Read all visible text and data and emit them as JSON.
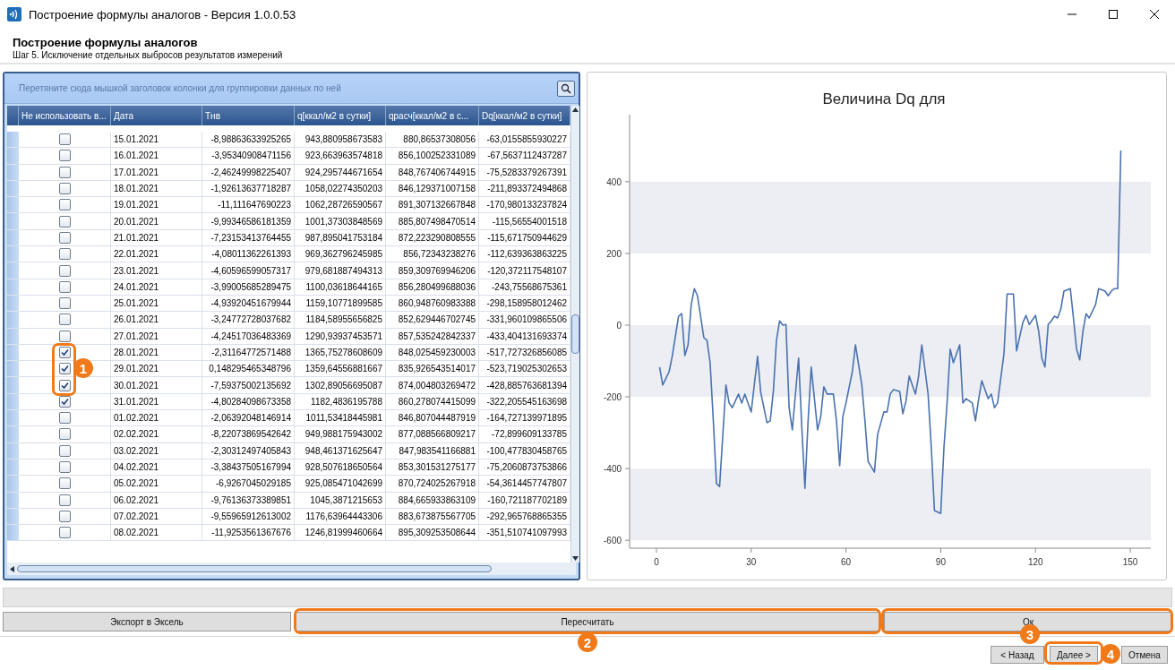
{
  "window": {
    "title": "Построение формулы аналогов - Версия 1.0.0.53"
  },
  "header": {
    "title": "Построение формулы аналогов",
    "subtitle": "Шаг 5. Исключение отдельных выбросов результатов измерений"
  },
  "grid": {
    "group_hint": "Перетяните сюда мышкой заголовок колонки для группировки данных по ней",
    "check_column": "Не использовать в...",
    "columns": [
      "Дата",
      "Тнв",
      "q[ккал/м2 в сутки]",
      "qрасч[ккал/м2 в с...",
      "Dq[ккал/м2 в сутки]"
    ],
    "rows": [
      {
        "excluded": false,
        "cells": [
          "15.01.2021",
          "-8,98863633925265",
          "943,880958673583",
          "880,86537308056",
          "-63,0155855930227"
        ]
      },
      {
        "excluded": false,
        "cells": [
          "16.01.2021",
          "-3,95340908471156",
          "923,663963574818",
          "856,100252331089",
          "-67,5637112437287"
        ]
      },
      {
        "excluded": false,
        "cells": [
          "17.01.2021",
          "-2,46249998225407",
          "924,295744671654",
          "848,767406744915",
          "-75,5283379267391"
        ]
      },
      {
        "excluded": false,
        "cells": [
          "18.01.2021",
          "-1,92613637718287",
          "1058,02274350203",
          "846,129371007158",
          "-211,893372494868"
        ]
      },
      {
        "excluded": false,
        "cells": [
          "19.01.2021",
          "-11,111647690223",
          "1062,28726590567",
          "891,307132667848",
          "-170,980133237824"
        ]
      },
      {
        "excluded": false,
        "cells": [
          "20.01.2021",
          "-9,99346586181359",
          "1001,37303848569",
          "885,807498470514",
          "-115,56554001518"
        ]
      },
      {
        "excluded": false,
        "cells": [
          "21.01.2021",
          "-7,23153413764455",
          "987,895041753184",
          "872,223290808555",
          "-115,671750944629"
        ]
      },
      {
        "excluded": false,
        "cells": [
          "22.01.2021",
          "-4,08011362261393",
          "969,362796245985",
          "856,72343238276",
          "-112,639363863225"
        ]
      },
      {
        "excluded": false,
        "cells": [
          "23.01.2021",
          "-4,60596599057317",
          "979,681887494313",
          "859,309769946206",
          "-120,372117548107"
        ]
      },
      {
        "excluded": false,
        "cells": [
          "24.01.2021",
          "-3,99005685289475",
          "1100,03618644165",
          "856,280499688036",
          "-243,75568675361"
        ]
      },
      {
        "excluded": false,
        "cells": [
          "25.01.2021",
          "-4,93920451679944",
          "1159,10771899585",
          "860,948760983388",
          "-298,158958012462"
        ]
      },
      {
        "excluded": false,
        "cells": [
          "26.01.2021",
          "-3,24772728037682",
          "1184,58955656825",
          "852,629446702745",
          "-331,960109865506"
        ]
      },
      {
        "excluded": false,
        "cells": [
          "27.01.2021",
          "-4,24517036483369",
          "1290,93937453571",
          "857,535242842337",
          "-433,404131693374"
        ]
      },
      {
        "excluded": true,
        "cells": [
          "28.01.2021",
          "-2,31164772571488",
          "1365,75278608609",
          "848,025459230003",
          "-517,727326856085"
        ]
      },
      {
        "excluded": true,
        "cells": [
          "29.01.2021",
          "0,148295465348796",
          "1359,64556881667",
          "835,926543514017",
          "-523,719025302653"
        ]
      },
      {
        "excluded": true,
        "cells": [
          "30.01.2021",
          "-7,59375002135692",
          "1302,89056695087",
          "874,004803269472",
          "-428,885763681394"
        ]
      },
      {
        "excluded": true,
        "cells": [
          "31.01.2021",
          "-4,80284098673358",
          "1182,4836195788",
          "860,278074415099",
          "-322,205545163698"
        ]
      },
      {
        "excluded": false,
        "cells": [
          "01.02.2021",
          "-2,06392048146914",
          "1011,53418445981",
          "846,807044487919",
          "-164,727139971895"
        ]
      },
      {
        "excluded": false,
        "cells": [
          "02.02.2021",
          "-8,22073869542642",
          "949,988175943002",
          "877,088566809217",
          "-72,899609133785"
        ]
      },
      {
        "excluded": false,
        "cells": [
          "03.02.2021",
          "-2,30312497405843",
          "948,461371625647",
          "847,983541166881",
          "-100,477830458765"
        ]
      },
      {
        "excluded": false,
        "cells": [
          "04.02.2021",
          "-3,38437505167994",
          "928,507618650564",
          "853,301531275177",
          "-75,2060873753866"
        ]
      },
      {
        "excluded": false,
        "cells": [
          "05.02.2021",
          "-6,9267045029185",
          "925,085471042699",
          "870,724025267918",
          "-54,3614457747807"
        ]
      },
      {
        "excluded": false,
        "cells": [
          "06.02.2021",
          "-9,76136373389851",
          "1045,3871215653",
          "884,665933863109",
          "-160,721187702189"
        ]
      },
      {
        "excluded": false,
        "cells": [
          "07.02.2021",
          "-9,55965912613002",
          "1176,63964443306",
          "883,673875567705",
          "-292,965768865355"
        ]
      },
      {
        "excluded": false,
        "cells": [
          "08.02.2021",
          "-11,9253561367676",
          "1246,81999460664",
          "895,309253508644",
          "-351,510741097993"
        ]
      }
    ]
  },
  "chart": {
    "chart_data": {
      "type": "line",
      "title": "Величина Dq для",
      "x": [
        1,
        2,
        4,
        5,
        7,
        8,
        9,
        10,
        11,
        12,
        13,
        15,
        16,
        17,
        18,
        19,
        20,
        22,
        23,
        24,
        26,
        27,
        28,
        30,
        32,
        33,
        35,
        36,
        37,
        38,
        39,
        40,
        41,
        42,
        43,
        45,
        46,
        47,
        48,
        49,
        51,
        52,
        53,
        54,
        56,
        57,
        58,
        59,
        60,
        62,
        63,
        65,
        66,
        67,
        69,
        70,
        72,
        73,
        74,
        75,
        77,
        78,
        79,
        80,
        82,
        83,
        84,
        86,
        87,
        88,
        90,
        91,
        92,
        93,
        94,
        96,
        97,
        98,
        100,
        101,
        102,
        103,
        105,
        106,
        107,
        108,
        110,
        111,
        113,
        114,
        116,
        117,
        118,
        120,
        121,
        122,
        123,
        124,
        125,
        126,
        127,
        128,
        129,
        131,
        132,
        133,
        134,
        135,
        136,
        137,
        139,
        140,
        142,
        143,
        144,
        145,
        146,
        147
      ],
      "series": [
        {
          "color": "#4a72b0",
          "values": [
            -117,
            -167,
            -130,
            -87,
            25,
            32,
            -85,
            -55,
            57,
            102,
            82,
            -35,
            -42,
            -105,
            -267,
            -442,
            -450,
            -167,
            -217,
            -230,
            -192,
            -217,
            -192,
            -242,
            -87,
            -187,
            -272,
            -267,
            -185,
            -42,
            12,
            0,
            2,
            -230,
            -292,
            -92,
            -280,
            -455,
            -267,
            -117,
            -292,
            -255,
            -172,
            -192,
            -192,
            -267,
            -392,
            -255,
            -217,
            -130,
            -55,
            -167,
            -267,
            -380,
            -410,
            -305,
            -242,
            -242,
            -192,
            -180,
            -185,
            -247,
            -212,
            -142,
            -192,
            -142,
            -55,
            -192,
            -342,
            -517,
            -525,
            -342,
            -217,
            -67,
            -105,
            -55,
            -217,
            -205,
            -217,
            -267,
            -205,
            -155,
            -205,
            -192,
            -230,
            -217,
            -80,
            87,
            87,
            -72,
            7,
            27,
            2,
            27,
            -17,
            -92,
            -117,
            2,
            12,
            25,
            20,
            45,
            95,
            102,
            20,
            -67,
            -97,
            -17,
            32,
            20,
            57,
            102,
            95,
            82,
            95,
            102,
            102,
            487
          ]
        }
      ],
      "xlim": [
        -8.5,
        156.5
      ],
      "ylim": [
        -622,
        587
      ],
      "xticks": [
        0,
        30,
        60,
        90,
        120,
        150
      ],
      "yticks": [
        -600,
        -400,
        -200,
        0,
        200,
        400
      ]
    }
  },
  "buttons": {
    "export": "Экспорт в Эксель",
    "recalc": "Пересчитать",
    "ok": "Ок"
  },
  "nav": {
    "back": "< Назад",
    "next": "Далее >",
    "cancel": "Отмена"
  },
  "annotations": [
    {
      "label": "1"
    },
    {
      "label": "2"
    },
    {
      "label": "3"
    },
    {
      "label": "4"
    }
  ]
}
